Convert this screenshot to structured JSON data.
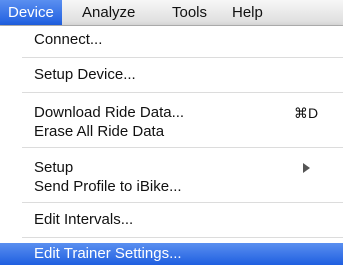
{
  "menubar": {
    "items": [
      {
        "label": "Device"
      },
      {
        "label": "Analyze"
      },
      {
        "label": "Tools"
      },
      {
        "label": "Help"
      }
    ]
  },
  "menu": {
    "items": [
      {
        "label": "Connect..."
      },
      {
        "label": "Setup Device..."
      },
      {
        "label": "Download Ride Data...",
        "shortcut": "⌘D"
      },
      {
        "label": "Erase All Ride Data"
      },
      {
        "label": "Setup"
      },
      {
        "label": "Send Profile to iBike..."
      },
      {
        "label": "Edit Intervals..."
      },
      {
        "label": "Edit Trainer Settings..."
      }
    ]
  },
  "colors": {
    "highlight": "#2f6ee8",
    "menubar_background": "#e6e6e6"
  }
}
